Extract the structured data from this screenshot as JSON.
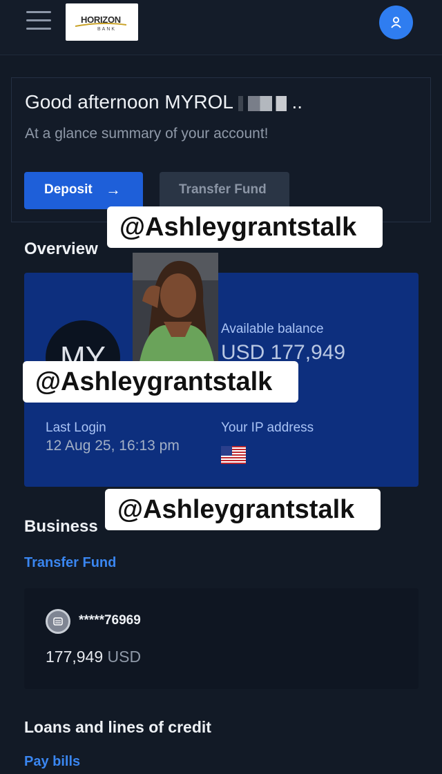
{
  "header": {
    "menu_icon": "hamburger-menu-icon",
    "logo": {
      "word": "HORIZON",
      "sub": "BANK"
    },
    "profile_icon": "user-icon"
  },
  "welcome": {
    "greeting": "Good afternoon MYROL",
    "greeting_suffix": "..",
    "subtitle": "At a glance summary of your account!",
    "deposit_label": "Deposit",
    "deposit_arrow": "→",
    "transfer_label": "Transfer Fund"
  },
  "overview": {
    "title": "Overview",
    "initials": "MY",
    "available_label": "Available balance",
    "available_value": "USD 177,949",
    "last_login_label": "Last Login",
    "last_login_value": "12 Aug 25, 16:13 pm",
    "ip_label": "Your IP address",
    "ip_flag": "us-flag-icon"
  },
  "business": {
    "title": "Business",
    "transfer_link": "Transfer Fund",
    "account_number": "*****76969",
    "balance_amount": "177,949",
    "balance_currency": "USD"
  },
  "loans": {
    "title": "Loans and lines of credit",
    "pay_bills_link": "Pay bills"
  },
  "watermarks": [
    "@Ashleygrantstalk",
    "@Ashleygrantstalk",
    "@Ashleygrantstalk"
  ],
  "colors": {
    "background": "#121a26",
    "accent": "#1e5fd9",
    "overview_card": "#0d2f7e",
    "link": "#3a86f0"
  }
}
